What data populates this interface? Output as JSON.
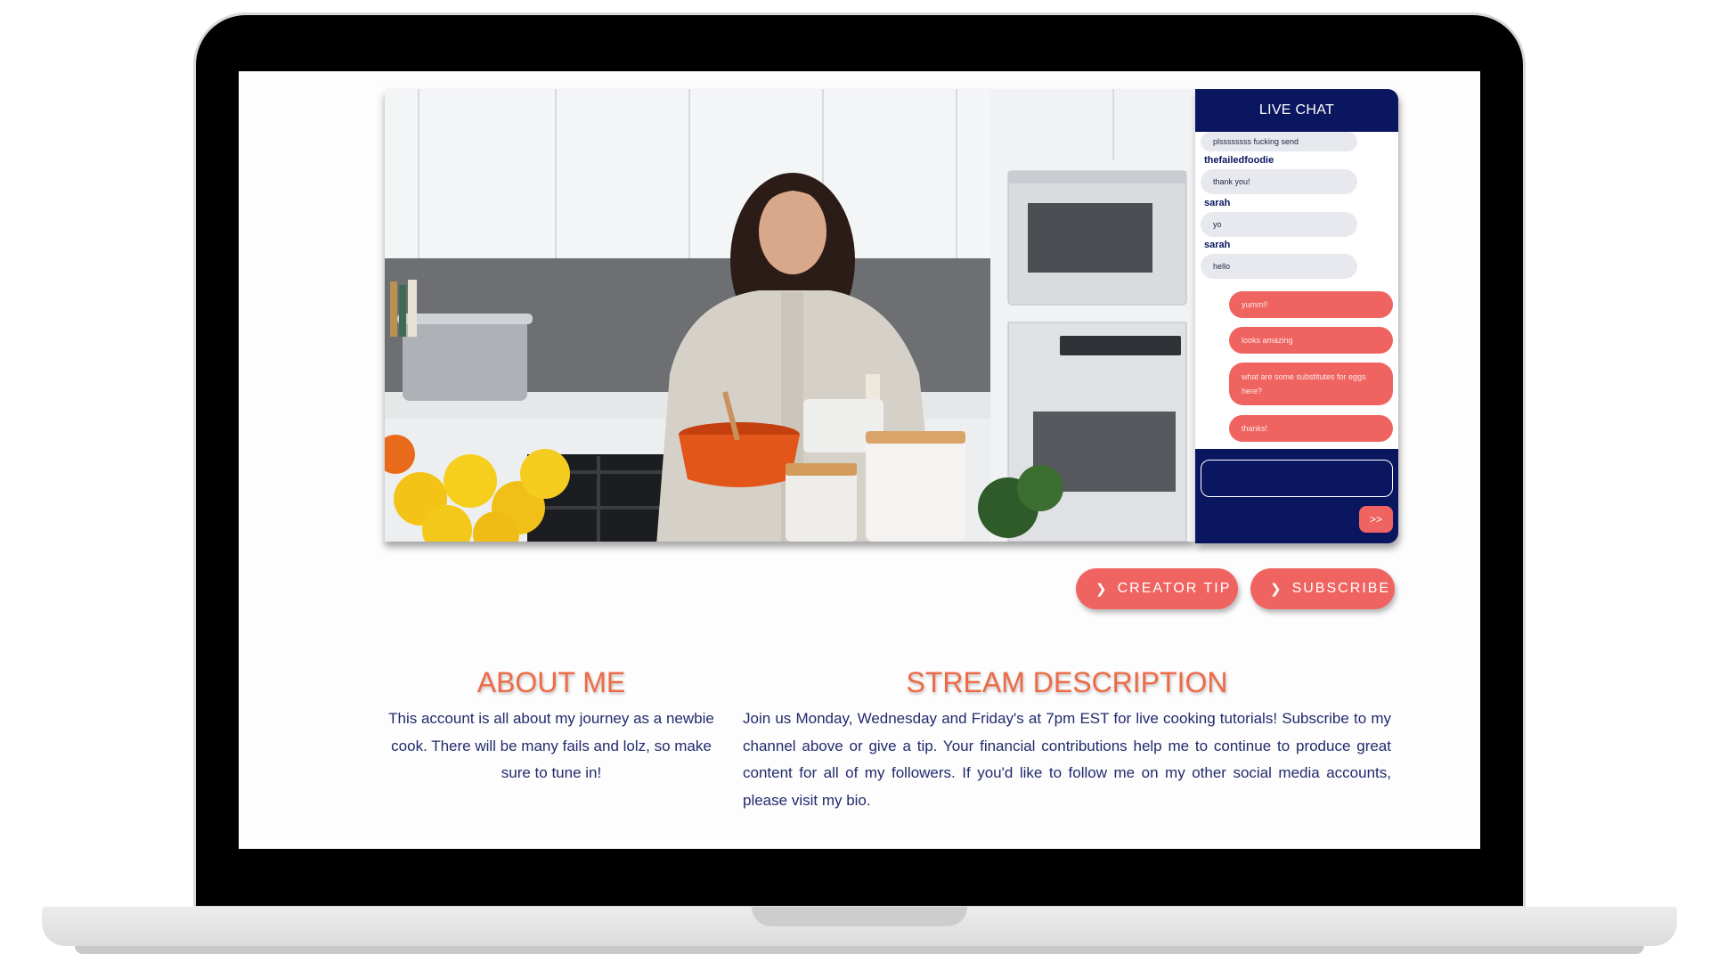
{
  "chat": {
    "title": "LIVE CHAT",
    "incoming": [
      {
        "text": "plssssssss fucking send"
      },
      {
        "username": "thefailedfoodie",
        "text": "thank you!"
      },
      {
        "username": "sarah",
        "text": "yo"
      },
      {
        "username": "sarah",
        "text": "hello"
      }
    ],
    "outgoing": [
      "yumm!!",
      "looks amazing",
      "what are some substitutes for eggs here?",
      "thanks!"
    ],
    "input_value": "",
    "send_label": ">>"
  },
  "actions": {
    "tip_label": "CREATOR TIP",
    "subscribe_label": "SUBSCRIBE"
  },
  "about": {
    "title": "ABOUT ME",
    "text": "This account is all about my journey as a newbie cook. There will be many fails and lolz, so make sure to tune in!"
  },
  "stream": {
    "title": "STREAM DESCRIPTION",
    "text": "Join us Monday, Wednesday and Friday's at 7pm EST for live cooking tutorials! Subscribe to my channel above or give a tip. Your financial contributions help me to continue to produce great content for all of my followers. If you'd like to follow me on my other social media accounts, please visit my bio."
  },
  "colors": {
    "navy": "#0b1660",
    "coral": "#ef6461",
    "title_orange": "#ee6a45",
    "text_navy": "#222a6b"
  },
  "icons": {
    "button_chevron": "chevron-right-icon"
  }
}
